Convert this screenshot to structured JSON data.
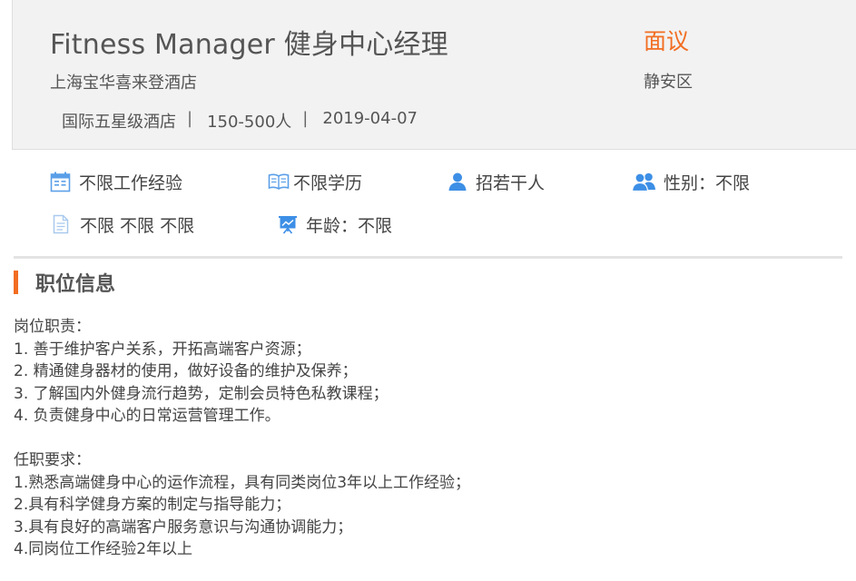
{
  "job": {
    "title": "Fitness Manager 健身中心经理",
    "salary": "面议",
    "company": "上海宝华喜来登酒店",
    "district": "静安区",
    "meta": [
      "国际五星级酒店",
      "150-500人",
      "2019-04-07"
    ],
    "separator": "|"
  },
  "requirements": {
    "experience": "不限工作经验",
    "education": "不限学历",
    "headcount": "招若干人",
    "gender": "性别：不限",
    "language": "不限 不限 不限",
    "age": "年龄：不限"
  },
  "icons": {
    "experience": "calendar-icon",
    "education": "open-book-icon",
    "headcount": "person-icon",
    "gender": "people-icon",
    "language": "document-icon",
    "age": "presentation-icon"
  },
  "colors": {
    "accent": "#f26d21",
    "icon_blue": "#3d8fe6"
  },
  "section": {
    "title": "职位信息",
    "duties_heading": "岗位职责：",
    "duties": [
      "1. 善于维护客户关系，开拓高端客户资源；",
      "2. 精通健身器材的使用，做好设备的维护及保养；",
      "3. 了解国内外健身流行趋势，定制会员特色私教课程；",
      "4. 负责健身中心的日常运营管理工作。"
    ],
    "qualifications_heading": "任职要求：",
    "qualifications": [
      "1.熟悉高端健身中心的运作流程，具有同类岗位3年以上工作经验；",
      "2.具有科学健身方案的制定与指导能力；",
      "3.具有良好的高端客户服务意识与沟通协调能力；",
      "4.同岗位工作经验2年以上"
    ]
  }
}
